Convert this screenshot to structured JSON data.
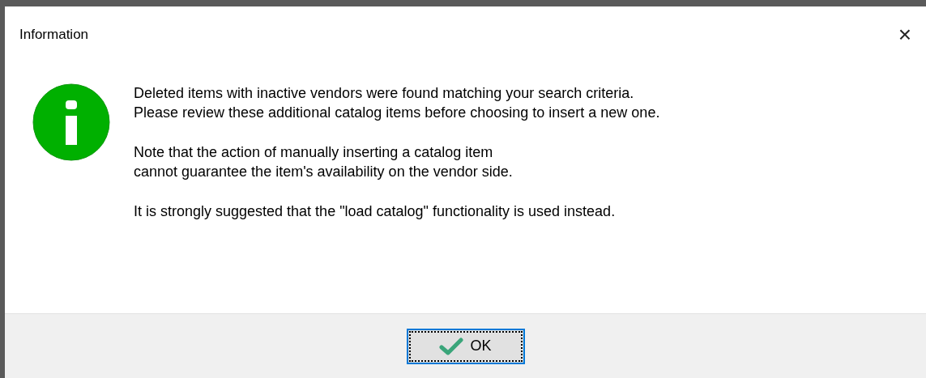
{
  "window": {
    "title": "Information",
    "close_glyph": "×"
  },
  "message": {
    "kind": "info",
    "paragraphs": [
      [
        "Deleted items with inactive vendors were found matching your search criteria.",
        "Please review these additional catalog items before choosing to insert a new one."
      ],
      [
        "Note that the action of manually inserting a catalog item",
        "cannot guarantee the item's availability on the vendor side."
      ],
      [
        "It is strongly suggested that the \"load catalog\" functionality is used instead."
      ]
    ]
  },
  "buttons": [
    {
      "label": "OK",
      "focused": true
    }
  ]
}
